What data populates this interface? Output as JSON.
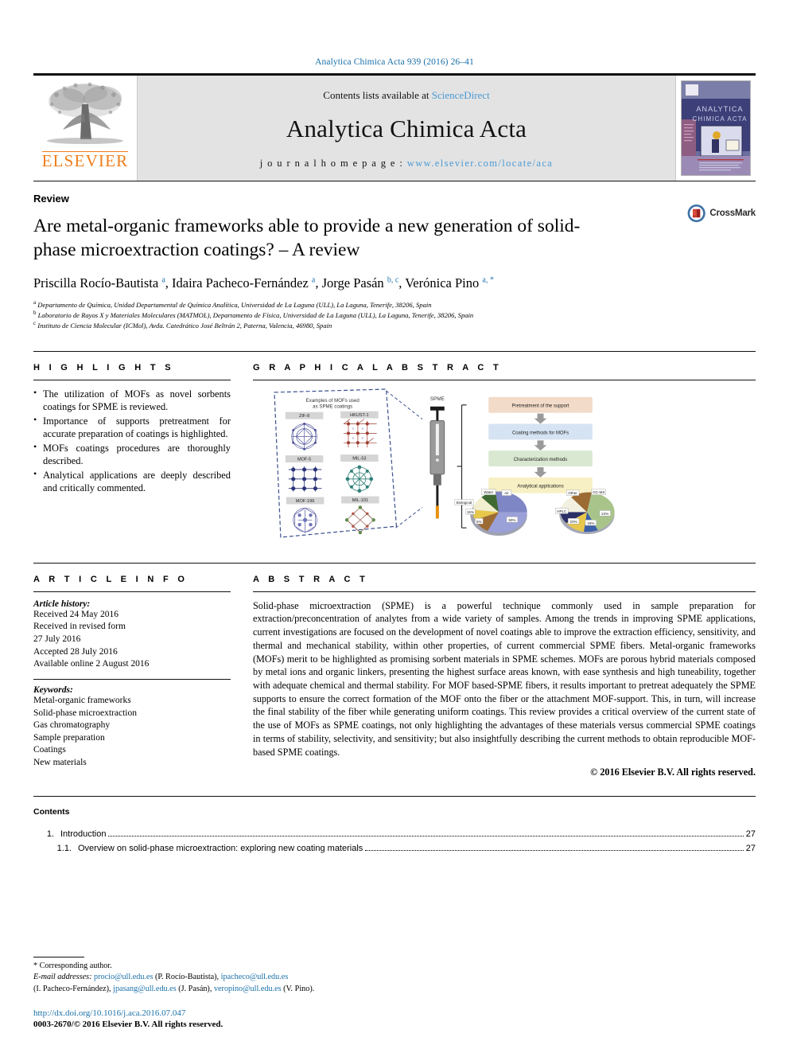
{
  "running_head": "Analytica Chimica Acta 939 (2016) 26–41",
  "masthead": {
    "contents_prefix": "Contents lists available at ",
    "sciencedirect": "ScienceDirect",
    "journal_title": "Analytica Chimica Acta",
    "homepage_label": "j o u r n a l   h o m e p a g e :",
    "homepage_url": "www.elsevier.com/locate/aca",
    "publisher": "ELSEVIER",
    "cover_title_line1": "ANALYTICA",
    "cover_title_line2": "CHIMICA ACTA",
    "accent_blue": "#4a9ad4",
    "elsevier_orange": "#ef7d1a"
  },
  "article": {
    "kind": "Review",
    "title": "Are metal-organic frameworks able to provide a new generation of solid-phase microextraction coatings? – A review",
    "authors_html": "Priscilla Rocío-Bautista <sup>a</sup>, Idaira Pacheco-Fernández <sup>a</sup>, Jorge Pasán <sup>b, c</sup>, Verónica Pino <sup>a, *</sup>",
    "affiliations": [
      "Departamento de Química, Unidad Departamental de Química Analítica, Universidad de La Laguna (ULL), La Laguna, Tenerife, 38206, Spain",
      "Laboratorio de Rayos X y Materiales Moleculares (MATMOL), Departamento de Física, Universidad de La Laguna (ULL), La Laguna, Tenerife, 38206, Spain",
      "Instituto de Ciencia Molecular (ICMol), Avda. Catedrático José Beltrán 2, Paterna, Valencia, 46980, Spain"
    ],
    "affil_marks": [
      "a",
      "b",
      "c"
    ],
    "crossmark_label": "CrossMark"
  },
  "highlights": {
    "heading": "H I G H L I G H T S",
    "items": [
      "The utilization of MOFs as novel sorbents coatings for SPME is reviewed.",
      "Importance of supports pretreatment for accurate preparation of coatings is highlighted.",
      "MOFs coatings procedures are thoroughly described.",
      "Analytical applications are deeply described and critically commented."
    ]
  },
  "graphical_abstract": {
    "heading": "G R A P H I C A L   A B S T R A C T",
    "panel_title": "Examples of MOFs used as SPME coatings",
    "mof_labels": [
      "ZIF-8",
      "HKUST-1",
      "MOF-5",
      "MIL-53",
      "MOF-199",
      "MIL-101"
    ],
    "spme_label": "SPME",
    "flow_steps": [
      "Pretreatment of the support",
      "Coating methods for MOFs",
      "Characterization methods",
      "Analytical applications"
    ],
    "flow_colors": [
      "#f2dbc8",
      "#d6e3f2",
      "#d9e8d0",
      "#f7f0c4"
    ],
    "pie_left_labels": [
      "50%",
      "5%",
      "15%",
      "Biological",
      "Water",
      "Air"
    ],
    "pie_right_labels": [
      "GC-MS",
      "24%",
      "15%",
      "20%",
      "10%",
      "HPLC",
      "Other"
    ]
  },
  "article_info": {
    "heading": "A R T I C L E   I N F O",
    "history_label": "Article history:",
    "history": [
      "Received 24 May 2016",
      "Received in revised form",
      "27 July 2016",
      "Accepted 28 July 2016",
      "Available online 2 August 2016"
    ],
    "keywords_label": "Keywords:",
    "keywords": [
      "Metal-organic frameworks",
      "Solid-phase microextraction",
      "Gas chromatography",
      "Sample preparation",
      "Coatings",
      "New materials"
    ]
  },
  "abstract": {
    "heading": "A B S T R A C T",
    "text": "Solid-phase microextraction (SPME) is a powerful technique commonly used in sample preparation for extraction/preconcentration of analytes from a wide variety of samples. Among the trends in improving SPME applications, current investigations are focused on the development of novel coatings able to improve the extraction efficiency, sensitivity, and thermal and mechanical stability, within other properties, of current commercial SPME fibers. Metal-organic frameworks (MOFs) merit to be highlighted as promising sorbent materials in SPME schemes. MOFs are porous hybrid materials composed by metal ions and organic linkers, presenting the highest surface areas known, with ease synthesis and high tuneability, together with adequate chemical and thermal stability. For MOF based-SPME fibers, it results important to pretreat adequately the SPME supports to ensure the correct formation of the MOF onto the fiber or the attachment MOF-support. This, in turn, will increase the final stability of the fiber while generating uniform coatings. This review provides a critical overview of the current state of the use of MOFs as SPME coatings, not only highlighting the advantages of these materials versus commercial SPME coatings in terms of stability, selectivity, and sensitivity; but also insightfully describing the current methods to obtain reproducible MOF-based SPME coatings.",
    "copyright": "© 2016 Elsevier B.V. All rights reserved."
  },
  "contents": {
    "heading": "Contents",
    "entries": [
      {
        "number": "1.",
        "label": "Introduction",
        "page": "27",
        "level": 0
      },
      {
        "number": "1.1.",
        "label": "Overview on solid-phase microextraction: exploring new coating materials",
        "page": "27",
        "level": 1
      }
    ]
  },
  "footnotes": {
    "corresponding": "Corresponding author.",
    "email_label": "E-mail addresses:",
    "emails": [
      {
        "address": "procio@ull.edu.es",
        "person": "(P. Rocío-Bautista),"
      },
      {
        "address": "ipacheco@ull.edu.es",
        "person": "(I. Pacheco-Fernández),"
      },
      {
        "address": "jpasang@ull.edu.es",
        "person": "(J. Pasán),"
      },
      {
        "address": "veropino@ull.edu.es",
        "person": "(V. Pino)."
      }
    ],
    "doi": "http://dx.doi.org/10.1016/j.aca.2016.07.047",
    "issn": "0003-2670/© 2016 Elsevier B.V. All rights reserved."
  }
}
